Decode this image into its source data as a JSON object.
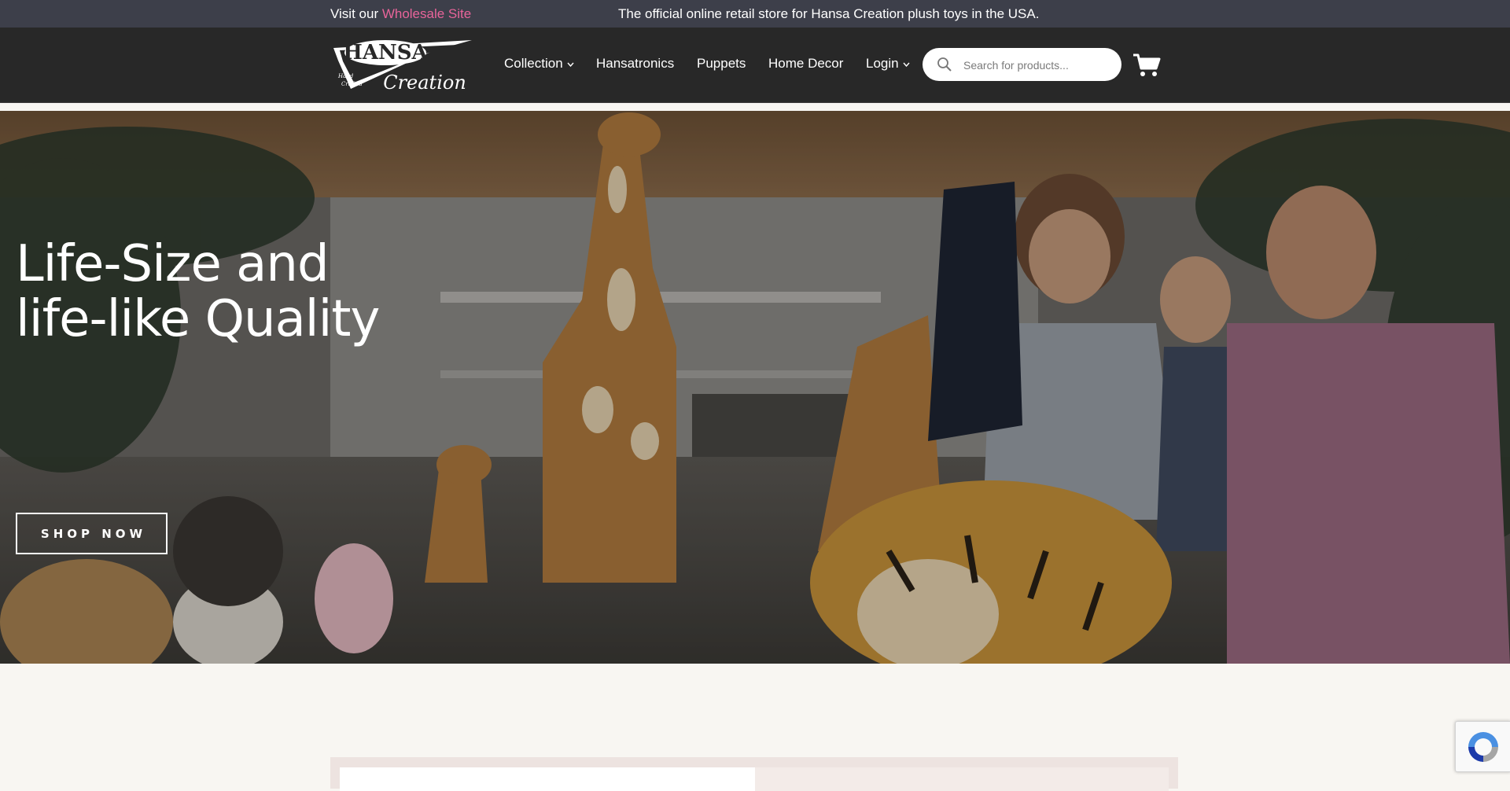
{
  "topbar": {
    "visit_prefix": "Visit our ",
    "wholesale_link": "Wholesale Site",
    "official_text": "The official online retail store for Hansa Creation plush toys in the USA."
  },
  "logo": {
    "brand": "HANSA",
    "script": "Creation",
    "tagline_1": "Hand",
    "tagline_2": "Crafted"
  },
  "nav": {
    "items": [
      {
        "label": "Collection",
        "has_dropdown": true
      },
      {
        "label": "Hansatronics",
        "has_dropdown": false
      },
      {
        "label": "Puppets",
        "has_dropdown": false
      },
      {
        "label": "Home Decor",
        "has_dropdown": false
      },
      {
        "label": "Login",
        "has_dropdown": true
      }
    ]
  },
  "search": {
    "placeholder": "Search for products...",
    "icon": "search-icon"
  },
  "cart": {
    "icon": "cart-icon"
  },
  "hero": {
    "title_line_1": "Life-Size and",
    "title_line_2": "life-like Quality",
    "cta_label": "SHOP NOW"
  },
  "recaptcha": {
    "icon": "recaptcha-icon"
  },
  "colors": {
    "topbar_bg": "#3d3f4a",
    "nav_bg": "#282828",
    "wholesale_link": "#e8649a",
    "page_bg": "#f8f6f2"
  }
}
